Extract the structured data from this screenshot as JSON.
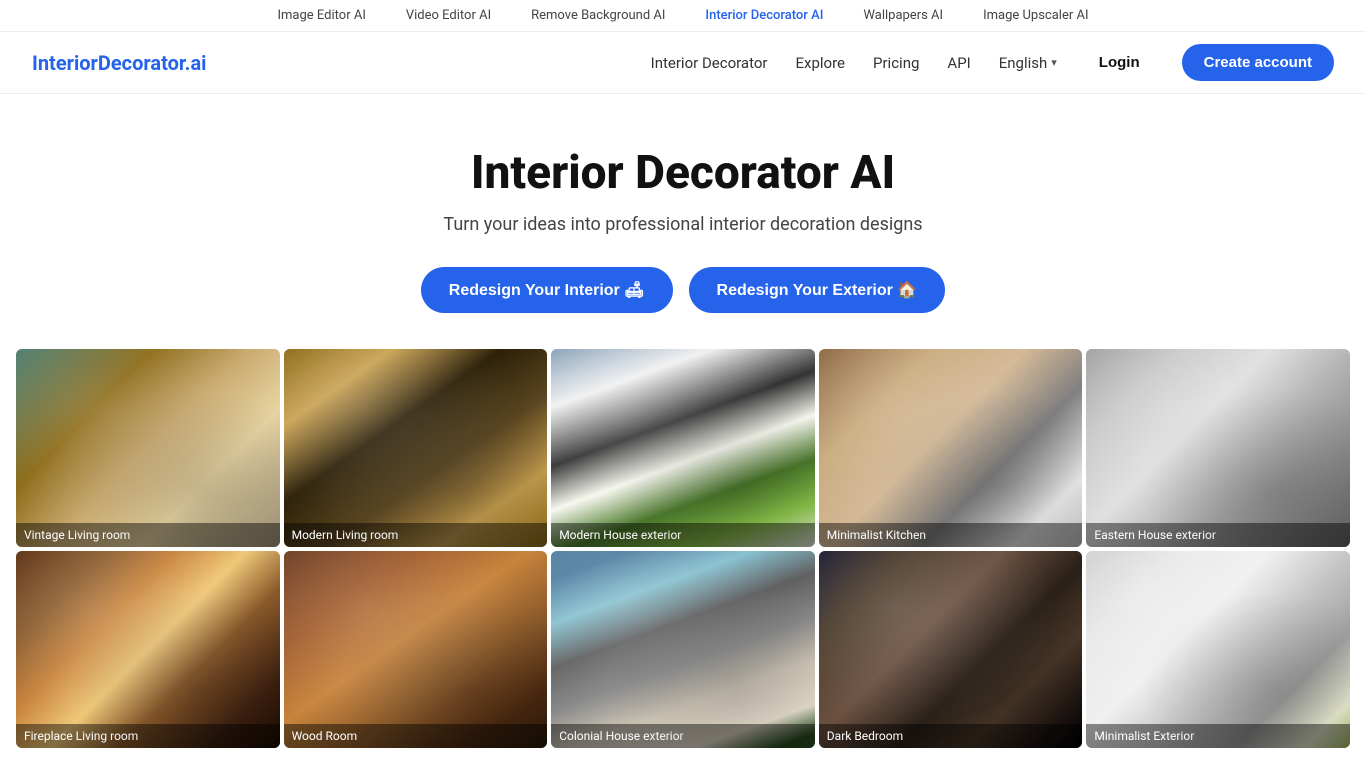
{
  "topbar": {
    "links": [
      {
        "label": "Image Editor AI",
        "active": false
      },
      {
        "label": "Video Editor AI",
        "active": false
      },
      {
        "label": "Remove Background AI",
        "active": false
      },
      {
        "label": "Interior Decorator AI",
        "active": true
      },
      {
        "label": "Wallpapers AI",
        "active": false
      },
      {
        "label": "Image Upscaler AI",
        "active": false
      }
    ]
  },
  "nav": {
    "logo": "InteriorDecorator.ai",
    "links": [
      {
        "label": "Interior Decorator"
      },
      {
        "label": "Explore"
      },
      {
        "label": "Pricing"
      },
      {
        "label": "API"
      }
    ],
    "language": "English",
    "login_label": "Login",
    "create_label": "Create account"
  },
  "hero": {
    "title": "Interior Decorator AI",
    "subtitle": "Turn your ideas into professional interior decoration designs",
    "btn_interior": "Redesign Your Interior 🛋",
    "btn_exterior": "Redesign Your Exterior 🏠"
  },
  "gallery": {
    "row1": [
      {
        "label": "Vintage Living room",
        "img_class": "img-vintage-living"
      },
      {
        "label": "Modern Living room",
        "img_class": "img-modern-living"
      },
      {
        "label": "Modern House exterior",
        "img_class": "img-modern-house"
      },
      {
        "label": "Minimalist Kitchen",
        "img_class": "img-minimalist-kitchen"
      },
      {
        "label": "Eastern House exterior",
        "img_class": "img-eastern-house"
      }
    ],
    "row2": [
      {
        "label": "Fireplace Living room",
        "img_class": "img-fireplace-room"
      },
      {
        "label": "Wood Room",
        "img_class": "img-wood-room"
      },
      {
        "label": "Colonial House exterior",
        "img_class": "img-colonial-house"
      },
      {
        "label": "Dark Bedroom",
        "img_class": "img-dark-bedroom"
      },
      {
        "label": "Minimalist Exterior",
        "img_class": "img-minimalist-exterior"
      }
    ]
  }
}
